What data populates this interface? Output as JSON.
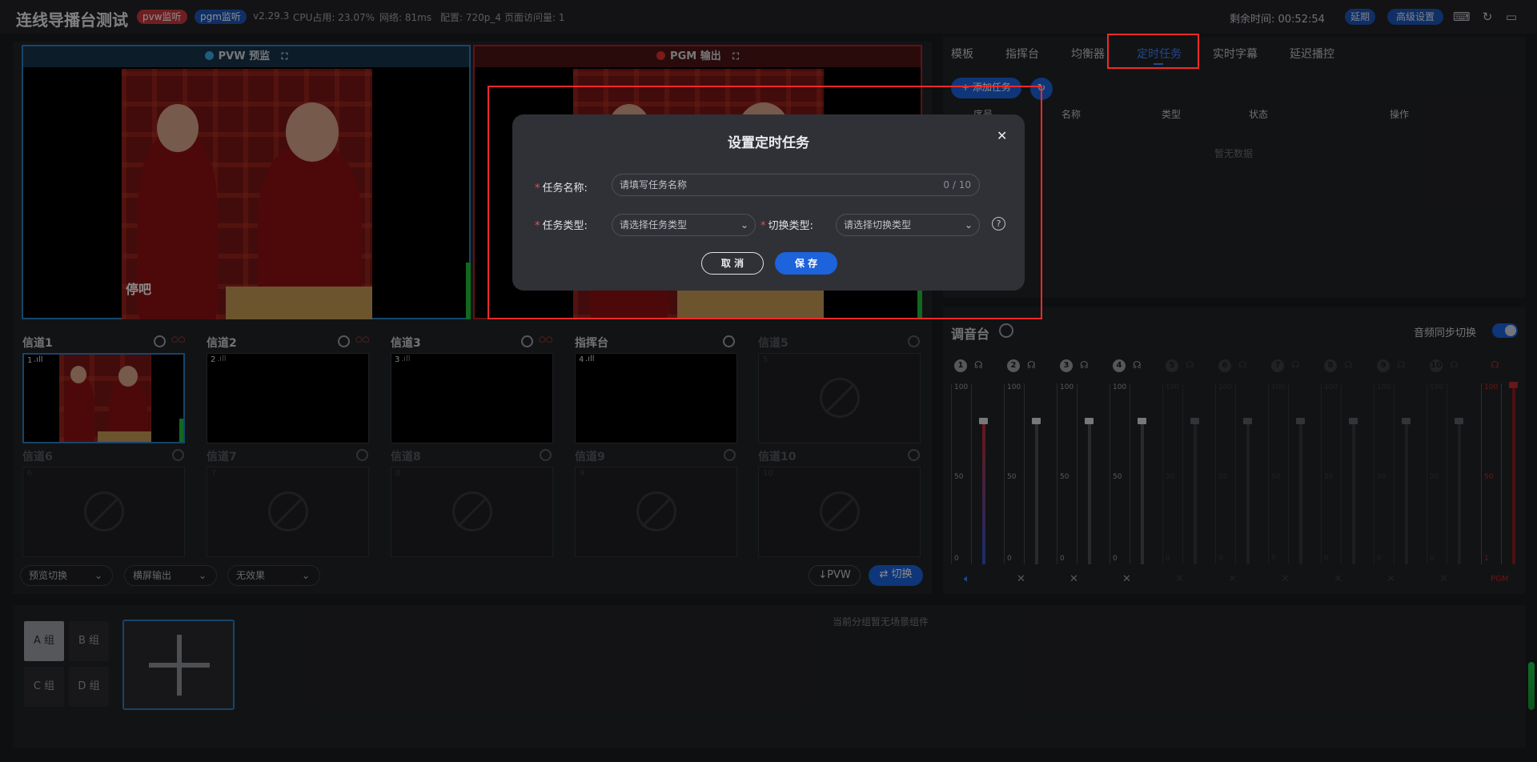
{
  "topbar": {
    "title": "连线导播台测试",
    "pvw_tag": "pvw监听",
    "pgm_tag": "pgm监听",
    "version": "v2.29.3",
    "cpu": "CPU占用: 23.07%",
    "network": "网络: 81ms",
    "config": "配置: 720p_4",
    "visits": "页面访问量: 1",
    "remaining": "剩余时间: 00:52:54",
    "extend_btn": "延期",
    "advanced_btn": "高级设置"
  },
  "monitors": {
    "pvw_title": "PVW 预监",
    "pgm_title": "PGM 输出",
    "pvw_caption": "停吧"
  },
  "channels": [
    {
      "label": "信道1",
      "num": "1",
      "active": true
    },
    {
      "label": "信道2",
      "num": "2",
      "active": true
    },
    {
      "label": "信道3",
      "num": "3",
      "active": true
    },
    {
      "label": "指挥台",
      "num": "4",
      "active": true
    },
    {
      "label": "信道5",
      "num": "5",
      "active": false
    },
    {
      "label": "信道6",
      "num": "6",
      "active": false
    },
    {
      "label": "信道7",
      "num": "7",
      "active": false
    },
    {
      "label": "信道8",
      "num": "8",
      "active": false
    },
    {
      "label": "信道9",
      "num": "9",
      "active": false
    },
    {
      "label": "信道10",
      "num": "10",
      "active": false
    }
  ],
  "controls": {
    "preview_switch": "预览切换",
    "landscape_output": "横屏输出",
    "effect": "无效果",
    "pvw_btn": "↓PVW",
    "switch_btn": "⇄ 切换"
  },
  "tabs": [
    "模板",
    "指挥台",
    "均衡器",
    "定时任务",
    "实时字幕",
    "延迟播控"
  ],
  "active_tab": "定时任务",
  "task_panel": {
    "add_task": "+ 添加任务",
    "columns": [
      "序号",
      "名称",
      "类型",
      "状态",
      "操作"
    ],
    "empty": "暂无数据"
  },
  "mixer": {
    "title": "调音台",
    "sync_label": "音频同步切换",
    "channels": [
      "1",
      "2",
      "3",
      "4",
      "5",
      "6",
      "7",
      "8",
      "9",
      "10"
    ],
    "scale_top": "100",
    "scale_mid": "50",
    "scale_bottom": "0",
    "pgm_label": "PGM",
    "pgm_bottom": "1"
  },
  "groups": {
    "items": [
      "A 组",
      "B 组",
      "C 组",
      "D 组"
    ],
    "empty_text": "当前分组暂无场景组件"
  },
  "dialog": {
    "title": "设置定时任务",
    "name_label": "任务名称:",
    "name_placeholder": "请填写任务名称",
    "name_counter": "0 / 10",
    "type_label": "任务类型:",
    "type_placeholder": "请选择任务类型",
    "switch_label": "切换类型:",
    "switch_placeholder": "请选择切换类型",
    "cancel": "取 消",
    "save": "保 存"
  },
  "colors": {
    "accent": "#1d63dc",
    "highlight_box": "#f22a2a",
    "active_tab": "#3f83ff"
  }
}
